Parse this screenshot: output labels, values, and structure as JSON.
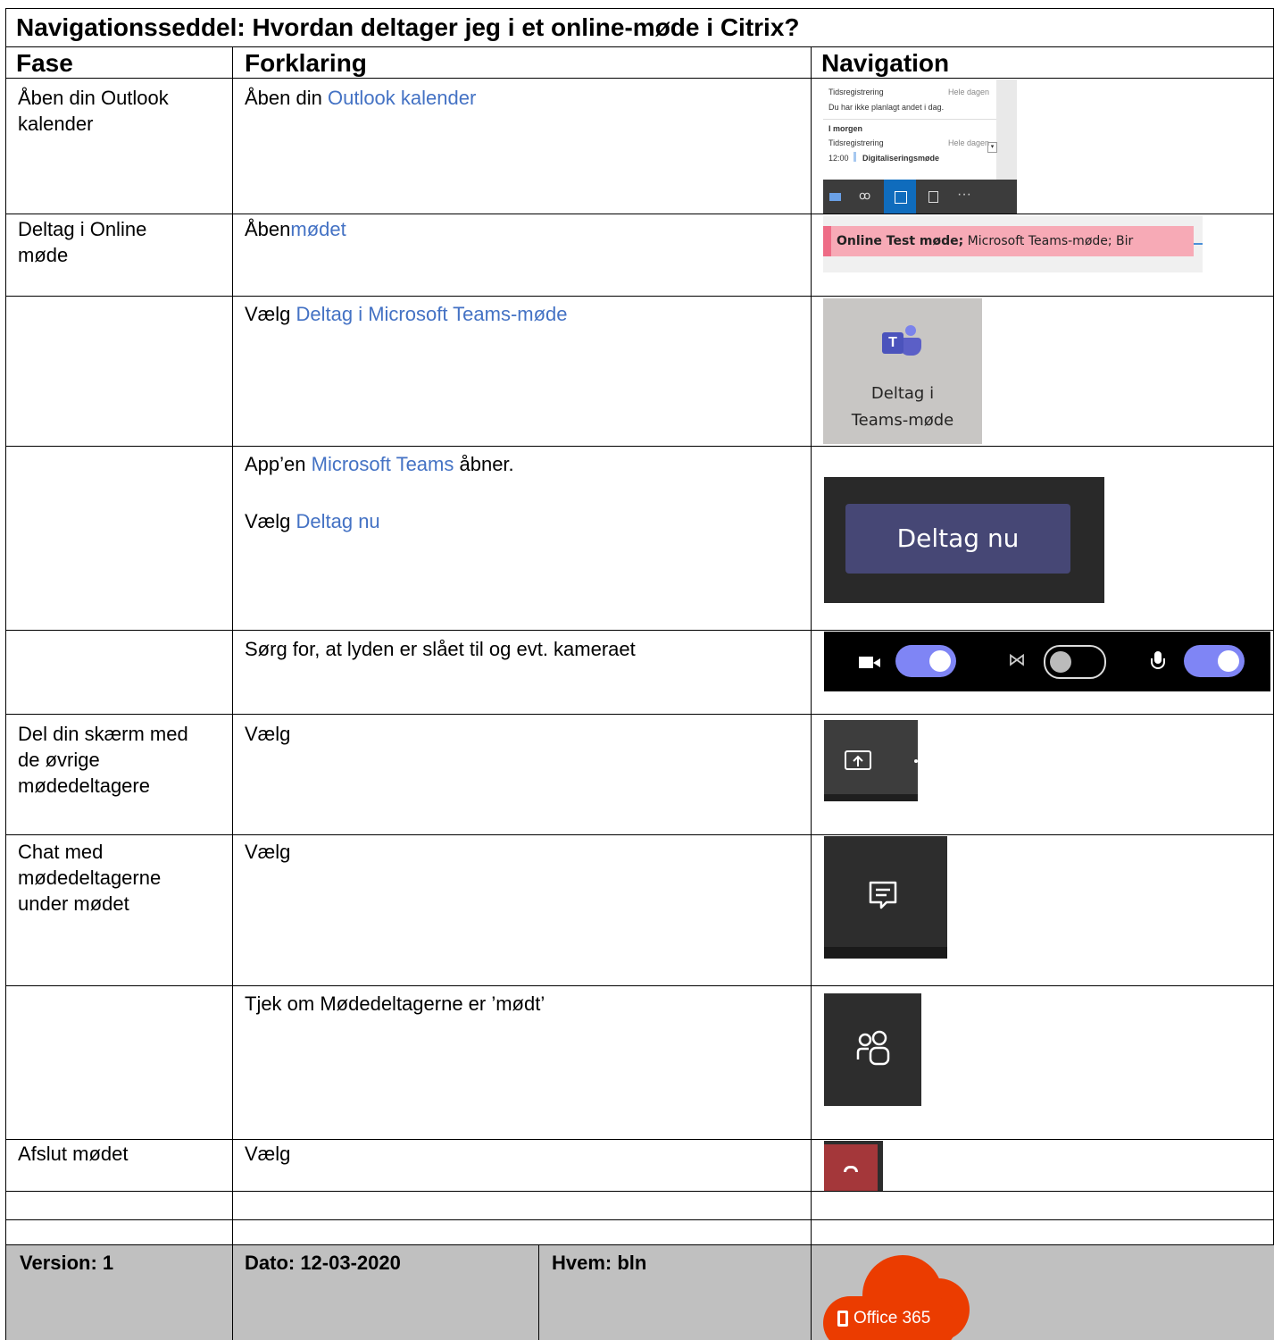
{
  "title": "Navigationsseddel: Hvordan deltager jeg i et online-møde i Citrix?",
  "columns": {
    "fase": "Fase",
    "forklaring": "Forklaring",
    "navigation": "Navigation"
  },
  "rows": [
    {
      "fase": "Åben din Outlook kalender",
      "pre": "Åben din ",
      "link": "Outlook kalender"
    },
    {
      "fase": "Deltag i Online møde",
      "pre": "Åben",
      "link": "mødet"
    },
    {
      "fase": "",
      "pre": "Vælg ",
      "link": "Deltag i Microsoft Teams-møde"
    },
    {
      "fase": "",
      "pre": "App’en ",
      "link": "Microsoft Teams",
      "post": " åbner.",
      "pre2": "Vælg ",
      "link2": "Deltag nu"
    },
    {
      "fase": "",
      "pre": "Sørg for, at lyden er slået til og evt. kameraet"
    },
    {
      "fase": "Del din skærm med de øvrige mødedeltagere",
      "pre": "Vælg"
    },
    {
      "fase": "Chat med mødedeltagerne under mødet",
      "pre": "Vælg"
    },
    {
      "fase": "",
      "pre": "Tjek om Mødedeltagerne er ’mødt’"
    },
    {
      "fase": "Afslut mødet",
      "pre": "Vælg"
    }
  ],
  "outlook_panel": {
    "row1_left": "Tidsregistrering",
    "row1_right": "Hele dagen",
    "row2": "Du har ikke planlagt andet i dag.",
    "row3": "I morgen",
    "row4_left": "Tidsregistrering",
    "row4_right": "Hele dagen",
    "row5_time": "12:00",
    "row5_title": "Digitaliseringsmøde"
  },
  "meeting_bar": {
    "bold": "Online Test møde;",
    "rest": " Microsoft Teams-møde; Bir"
  },
  "teams_button": {
    "line1": "Deltag i",
    "line2": "Teams-møde"
  },
  "deltag_nu": "Deltag nu",
  "footer": {
    "version": "Version: 1",
    "dato": "Dato: 12-03-2020",
    "hvem": "Hvem: bln"
  },
  "office_logo": "Office 365",
  "colors": {
    "link": "#4472c4",
    "footer_gray": "#c0c0c0",
    "teams_purple": "#5b5fc7",
    "hangup": "#a4373a",
    "office_orange": "#eb3c00"
  },
  "icons": [
    "envelope-icon",
    "people-icon",
    "calendar-icon",
    "tasks-icon",
    "more-icon",
    "teams-logo-icon",
    "camera-icon",
    "blur-icon",
    "microphone-icon",
    "share-screen-icon",
    "chat-icon",
    "participants-icon",
    "hangup-icon",
    "office-icon"
  ]
}
